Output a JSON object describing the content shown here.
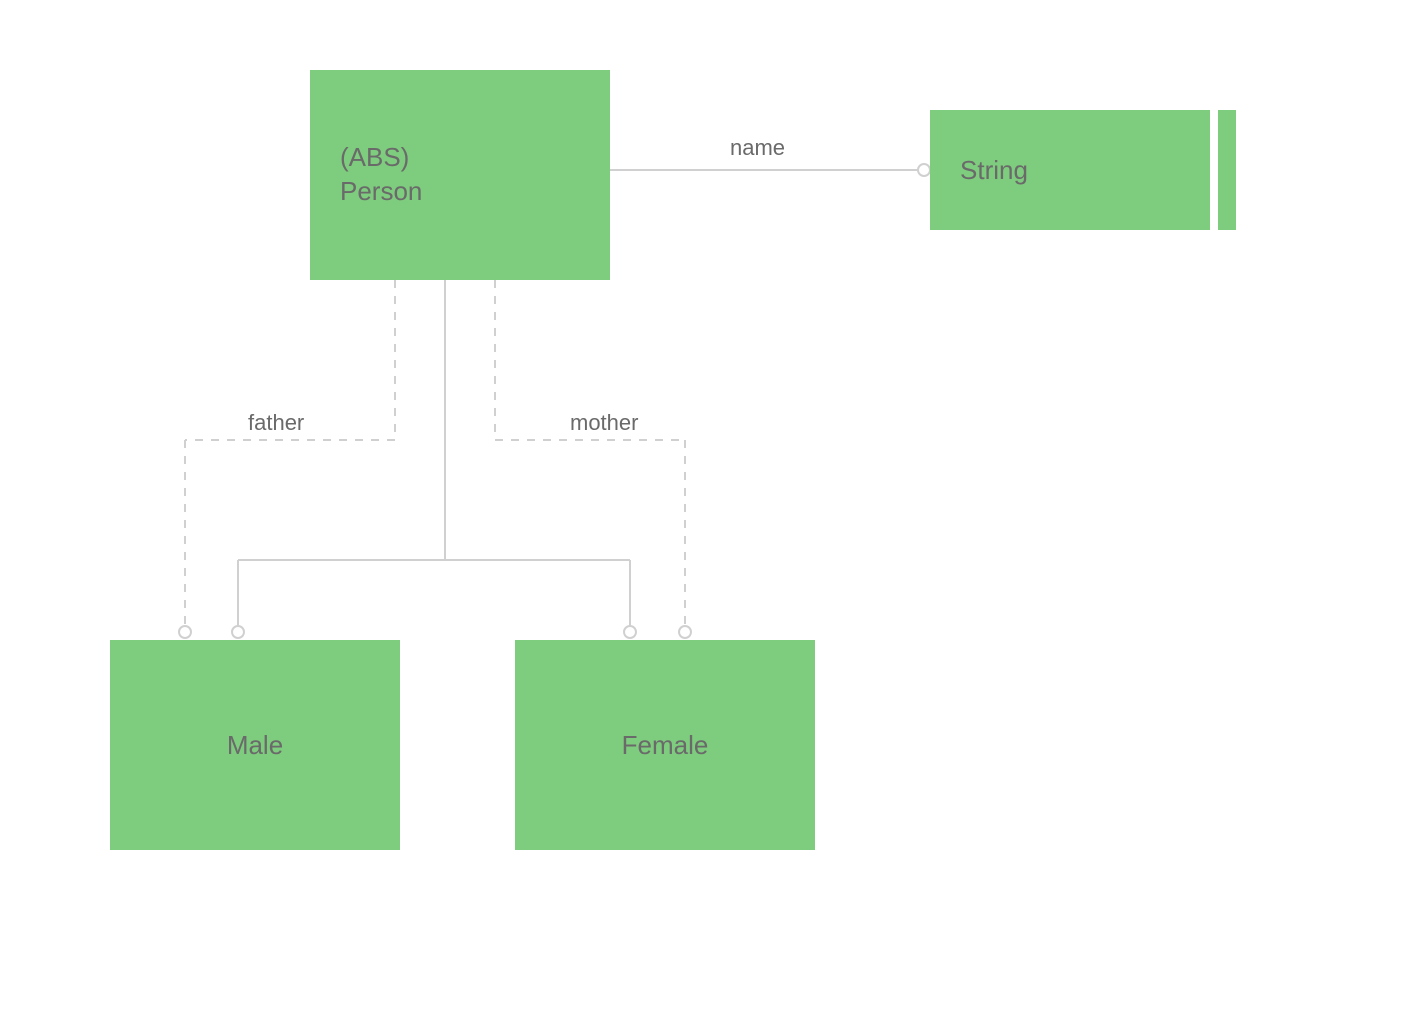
{
  "nodes": {
    "person": {
      "stereotype": "(ABS)",
      "name": "Person"
    },
    "string": {
      "name": "String"
    },
    "male": {
      "name": "Male"
    },
    "female": {
      "name": "Female"
    }
  },
  "edges": {
    "name": {
      "label": "name"
    },
    "father": {
      "label": "father"
    },
    "mother": {
      "label": "mother"
    }
  },
  "colors": {
    "node_fill": "#7ecc7e",
    "text": "#6a6a6a",
    "line": "#d0d0d0"
  }
}
